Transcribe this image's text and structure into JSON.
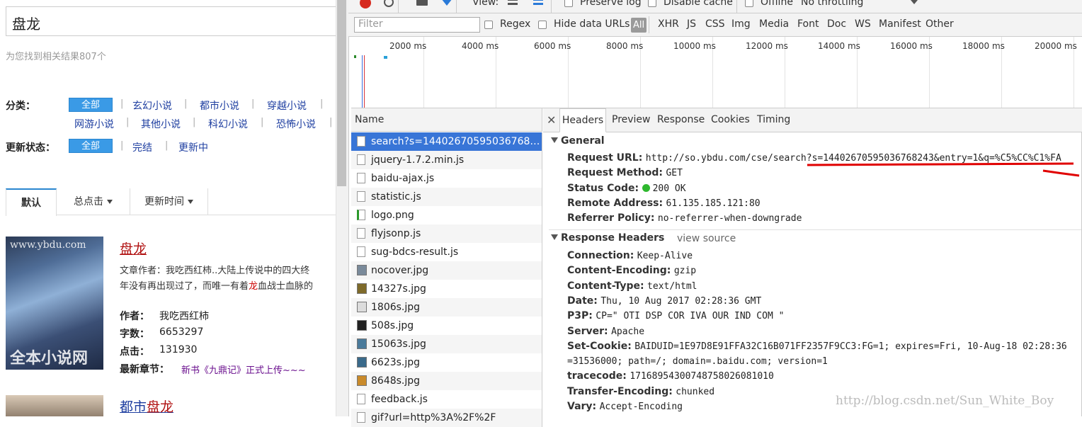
{
  "search": {
    "query": "盘龙",
    "result_count": "为您找到相关结果807个"
  },
  "filters": {
    "category_label": "分类：",
    "category_all": "全部",
    "categories": [
      "玄幻小说",
      "都市小说",
      "穿越小说",
      "网游小说",
      "其他小说",
      "科幻小说",
      "恐怖小说"
    ],
    "status_label": "更新状态：",
    "status_all": "全部",
    "statuses": [
      "完结",
      "更新中"
    ]
  },
  "sort_tabs": [
    "默认",
    "总点击",
    "更新时间"
  ],
  "books": [
    {
      "title": "盘龙",
      "cover_watermark_top": "www.ybdu.com",
      "cover_watermark_bottom": "全本小说网",
      "desc_line1": "文章作者：我吃西红柿..大陆上传说中的四大终",
      "desc_line2_a": "年没有再出现过了，而唯一有着",
      "desc_line2_hl": "龙",
      "desc_line2_b": "血战士血脉的",
      "author_label": "作者：",
      "author": "我吃西红柿",
      "words_label": "字数：",
      "words": "6653297",
      "clicks_label": "点击：",
      "clicks": "131930",
      "latest_label": "最新章节：",
      "latest": "新书《九鼎记》正式上传~~~"
    },
    {
      "title_a": "都市",
      "title_b": "盘龙"
    }
  ],
  "devtools": {
    "toolbar1": {
      "view_label": "View:",
      "preserve_log": "Preserve log",
      "disable_cache": "Disable cache",
      "offline": "Offline",
      "throttling": "No throttling"
    },
    "toolbar2": {
      "filter_placeholder": "Filter",
      "regex": "Regex",
      "hide_data_urls": "Hide data URLs",
      "all": "All",
      "types": [
        "XHR",
        "JS",
        "CSS",
        "Img",
        "Media",
        "Font",
        "Doc",
        "WS",
        "Manifest",
        "Other"
      ]
    },
    "timeline_ticks": [
      "2000 ms",
      "4000 ms",
      "6000 ms",
      "8000 ms",
      "10000 ms",
      "12000 ms",
      "14000 ms",
      "16000 ms",
      "18000 ms",
      "20000 ms"
    ],
    "name_header": "Name",
    "requests": [
      "search?s=14402670595036768243&entry=1&q=%C5%CC%C1%FA",
      "jquery-1.7.2.min.js",
      "baidu-ajax.js",
      "statistic.js",
      "logo.png",
      "flyjsonp.js",
      "sug-bdcs-result.js",
      "nocover.jpg",
      "14327s.jpg",
      "1806s.jpg",
      "508s.jpg",
      "15063s.jpg",
      "6623s.jpg",
      "8648s.jpg",
      "feedback.js",
      "gif?url=http%3A%2F%2F"
    ],
    "detail_tabs": [
      "Headers",
      "Preview",
      "Response",
      "Cookies",
      "Timing"
    ],
    "general": {
      "title": "General",
      "request_url_label": "Request URL:",
      "request_url": "http://so.ybdu.com/cse/search?s=14402670595036768243&entry=1&q=%C5%CC%C1%FA",
      "method_label": "Request Method:",
      "method": "GET",
      "status_label": "Status Code:",
      "status": "200 OK",
      "remote_label": "Remote Address:",
      "remote": "61.135.185.121:80",
      "referrer_label": "Referrer Policy:",
      "referrer": "no-referrer-when-downgrade"
    },
    "response_headers": {
      "title": "Response Headers",
      "view_source": "view source",
      "items": [
        {
          "k": "Connection:",
          "v": "Keep-Alive"
        },
        {
          "k": "Content-Encoding:",
          "v": "gzip"
        },
        {
          "k": "Content-Type:",
          "v": "text/html"
        },
        {
          "k": "Date:",
          "v": "Thu, 10 Aug 2017 02:28:36 GMT"
        },
        {
          "k": "P3P:",
          "v": "CP=\" OTI DSP COR IVA OUR IND COM \""
        },
        {
          "k": "Server:",
          "v": "Apache"
        },
        {
          "k": "Set-Cookie:",
          "v": "BAIDUID=1E97D8E91FFA32C16B071FF2357F9CC3:FG=1; expires=Fri, 10-Aug-18 02:28:36"
        },
        {
          "k": "",
          "v": "=31536000; path=/; domain=.baidu.com; version=1"
        },
        {
          "k": "tracecode:",
          "v": "17168954300748758026081010"
        },
        {
          "k": "Transfer-Encoding:",
          "v": "chunked"
        },
        {
          "k": "Vary:",
          "v": "Accept-Encoding"
        }
      ]
    },
    "watermark": "http://blog.csdn.net/Sun_White_Boy",
    "colors": {
      "selected_row": "#3875d7",
      "annotation": "#e00000",
      "status_ok": "#2eb82e"
    }
  }
}
